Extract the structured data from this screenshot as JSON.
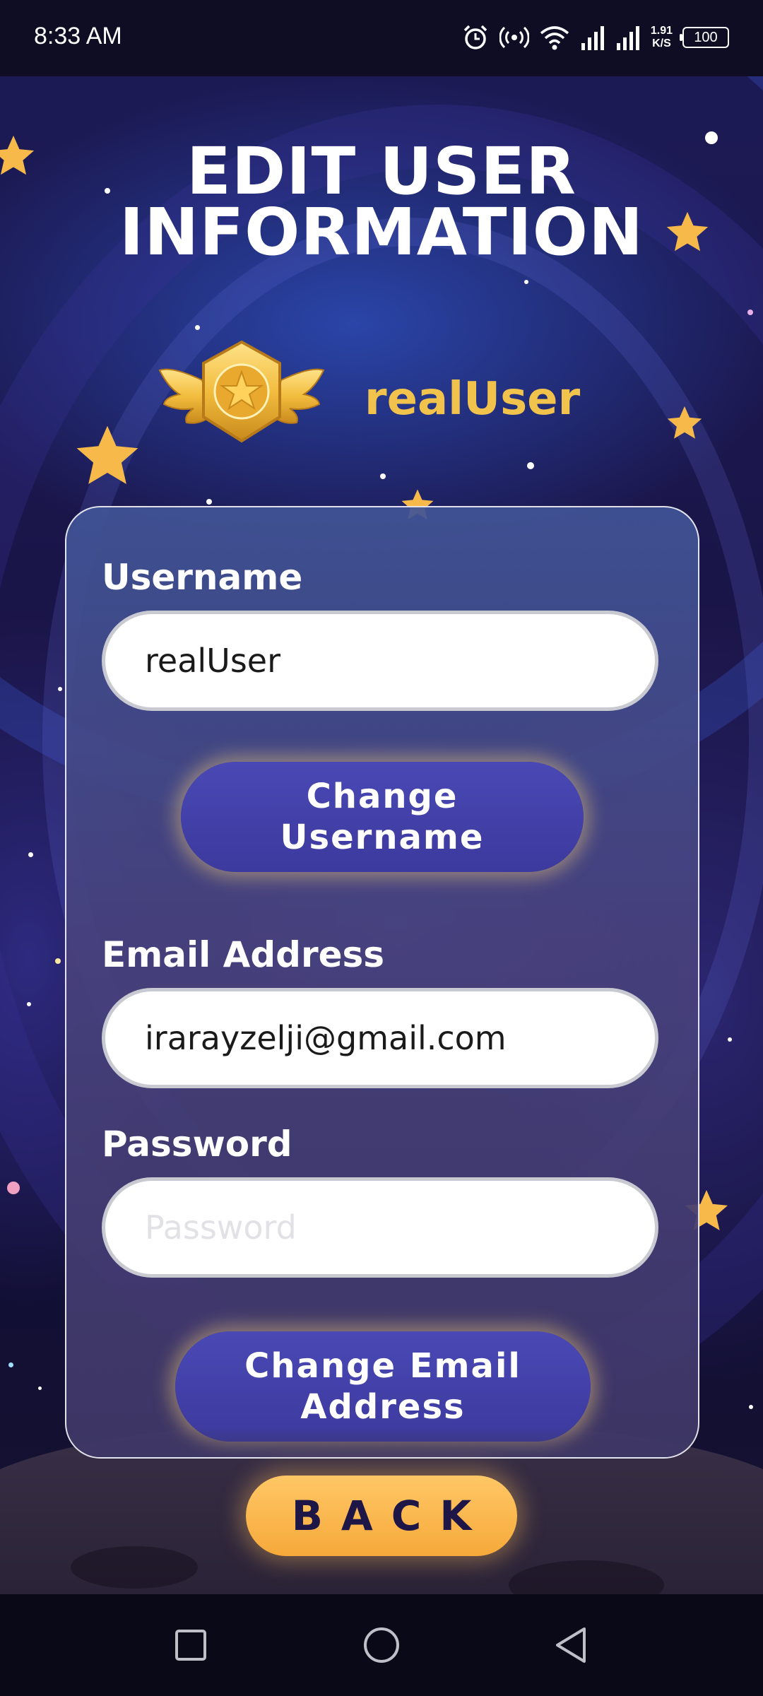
{
  "status_bar": {
    "time": "8:33 AM",
    "net_speed_value": "1.91",
    "net_speed_unit": "K/S",
    "battery": "100",
    "icons": [
      "alarm-icon",
      "hotspot-icon",
      "wifi-icon",
      "signal-icon",
      "signal-icon"
    ]
  },
  "header": {
    "title": "EDIT USER\nINFORMATION",
    "username": "realUser",
    "badge_icon": "gold-star-badge-icon"
  },
  "form": {
    "username_label": "Username",
    "username_value": "realUser",
    "change_username_button": "Change\nUsername",
    "email_label": "Email Address",
    "email_value": "irarayzelji@gmail.com",
    "password_label": "Password",
    "password_value": "",
    "password_placeholder": "Password",
    "change_email_button": "Change Email\nAddress"
  },
  "back_button": "BACK",
  "nav_bar": {
    "icons": [
      "recents-square-icon",
      "home-circle-icon",
      "back-triangle-icon"
    ]
  },
  "colors": {
    "accent_gold": "#f2c34c",
    "button_purple": "#3c3a9e",
    "back_button": "#f6a93a"
  }
}
